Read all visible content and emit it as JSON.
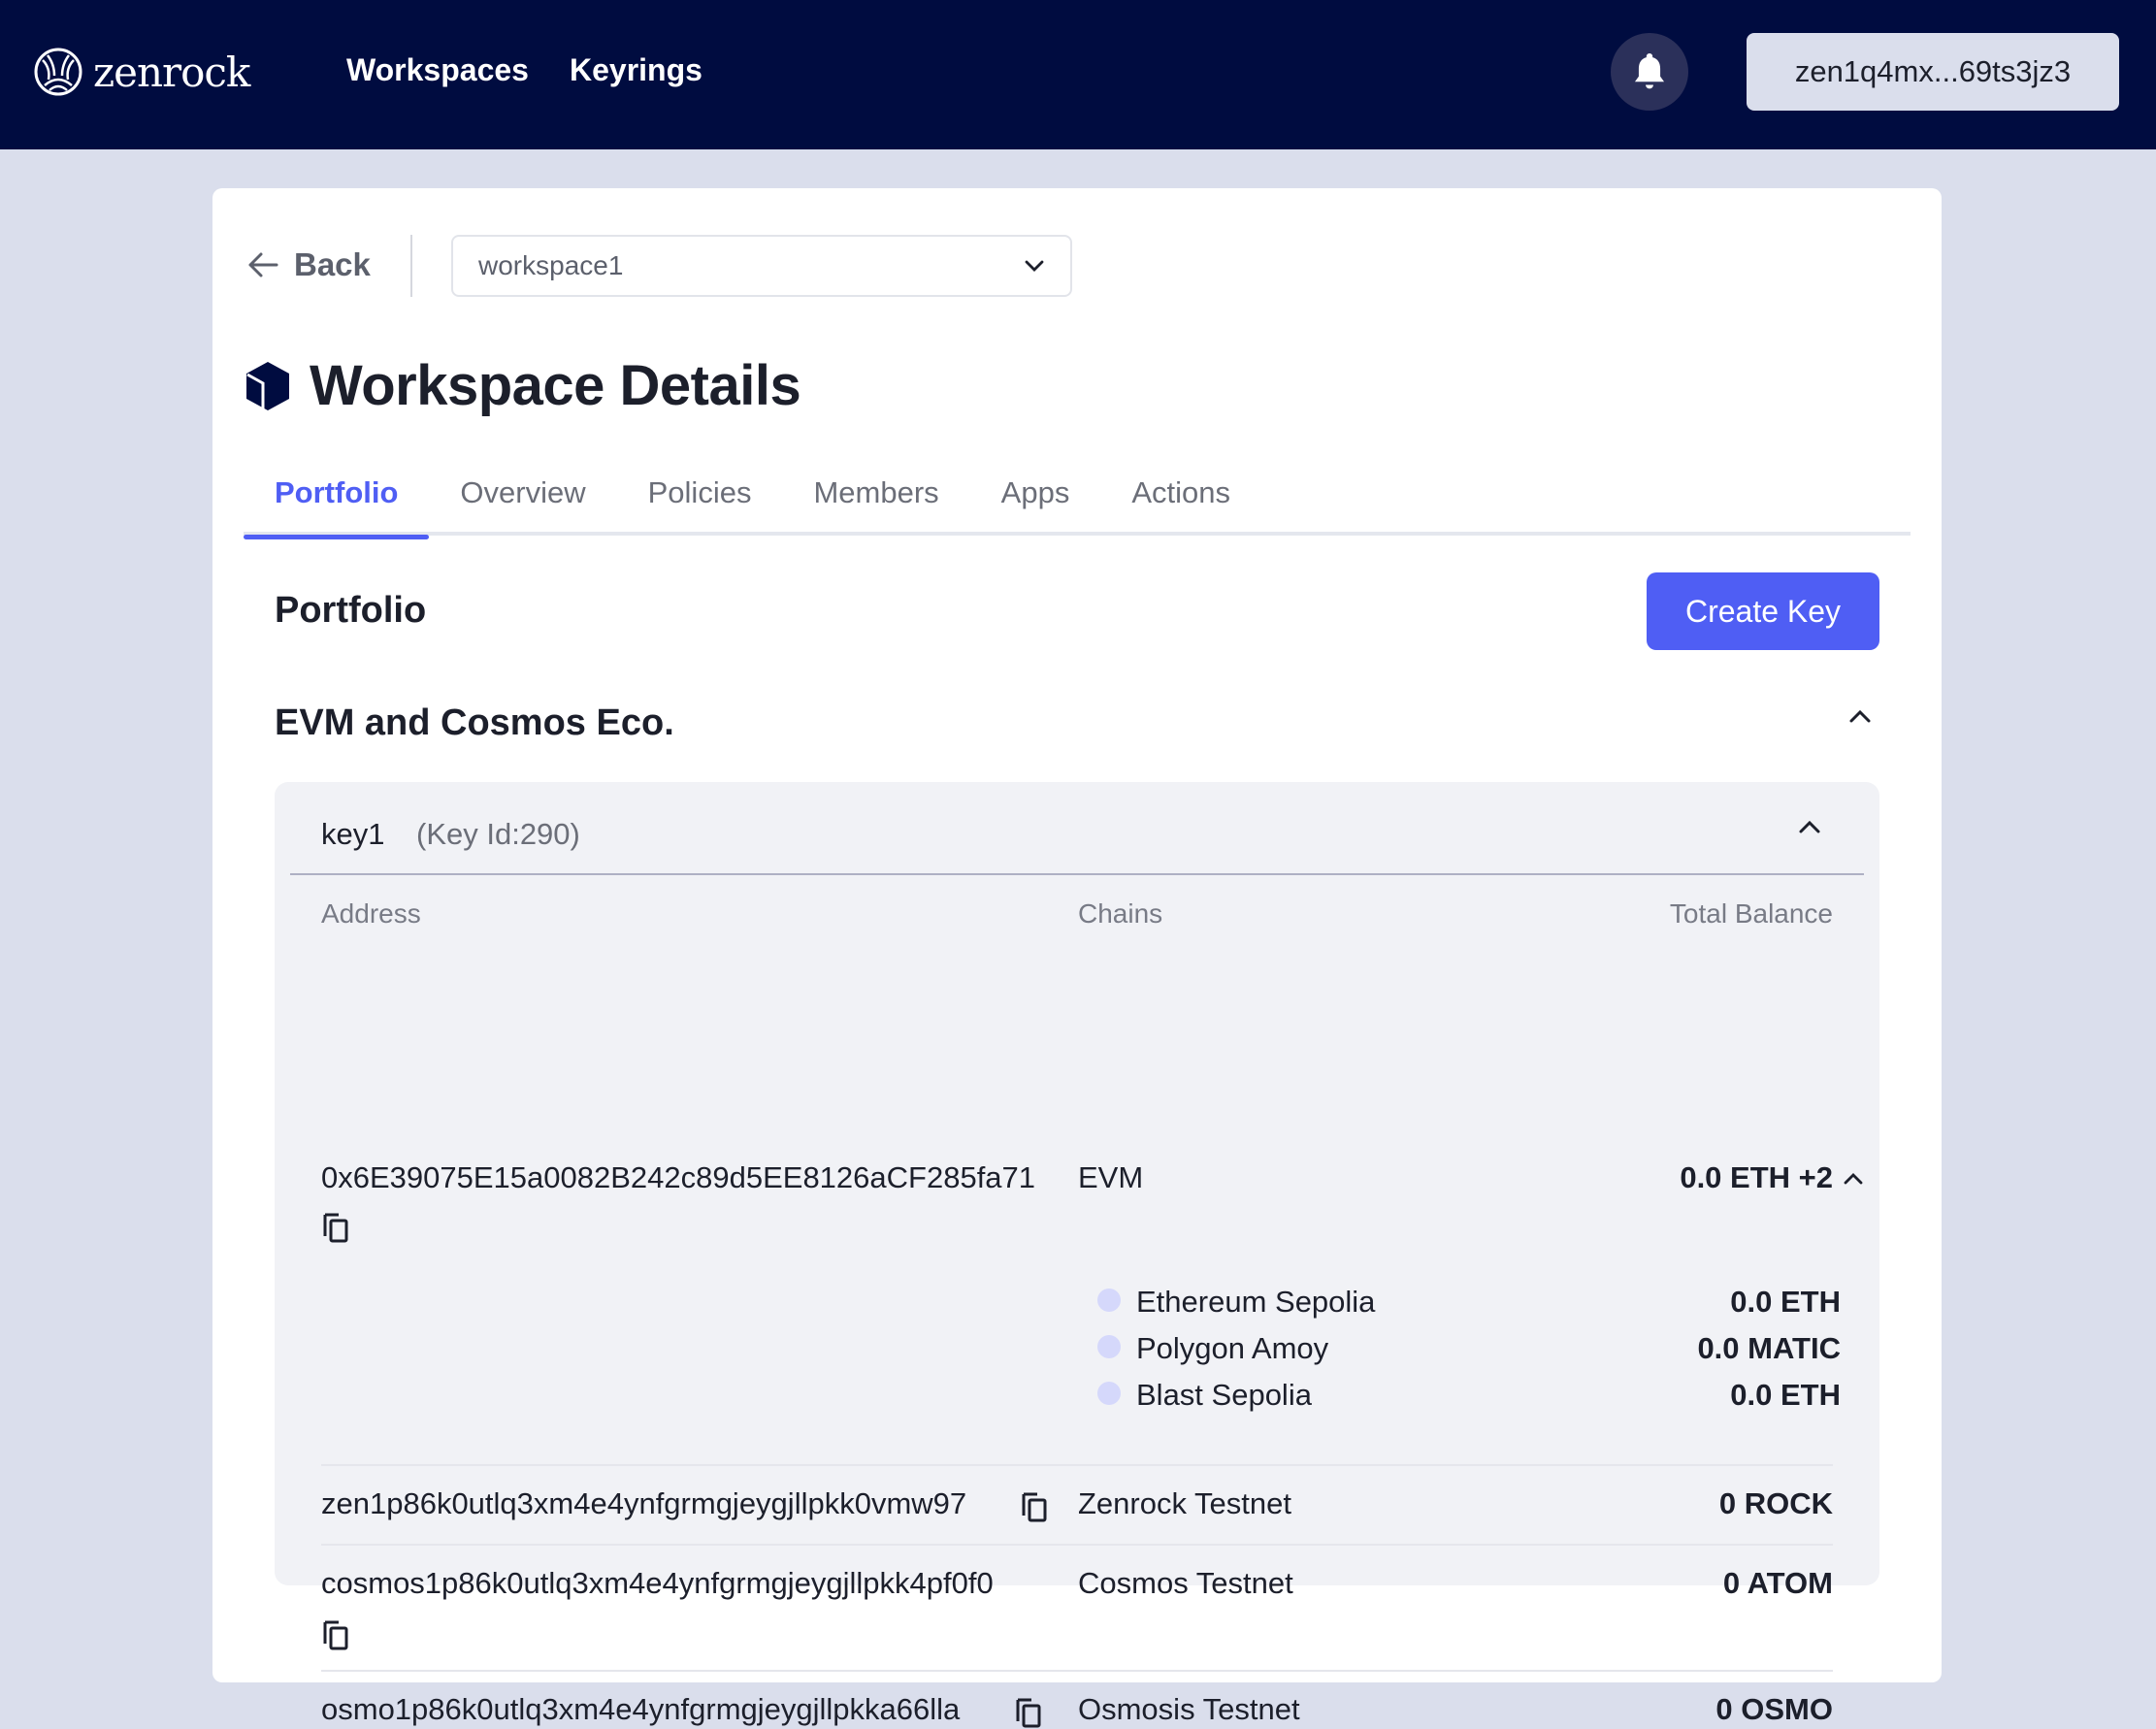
{
  "header": {
    "logo_text": "zenrock",
    "nav": [
      {
        "label": "Workspaces"
      },
      {
        "label": "Keyrings"
      }
    ],
    "wallet_address": "zen1q4mx...69ts3jz3"
  },
  "page": {
    "back_label": "Back",
    "workspace_select": {
      "value": "workspace1"
    },
    "title": "Workspace Details",
    "tabs": [
      {
        "label": "Portfolio",
        "active": true
      },
      {
        "label": "Overview",
        "active": false
      },
      {
        "label": "Policies",
        "active": false
      },
      {
        "label": "Members",
        "active": false
      },
      {
        "label": "Apps",
        "active": false
      },
      {
        "label": "Actions",
        "active": false
      }
    ],
    "section_title": "Portfolio",
    "create_key_label": "Create Key",
    "group_title": "EVM and Cosmos Eco."
  },
  "key": {
    "name": "key1",
    "id_label": "(Key Id:290)",
    "columns": {
      "address": "Address",
      "chains": "Chains",
      "balance": "Total Balance"
    },
    "rows": [
      {
        "address": "0x6E39075E15a0082B242c89d5EE8126aCF285fa71",
        "chain": "EVM",
        "balance": "0.0 ETH +2",
        "sub_chains": [
          {
            "name": "Ethereum Sepolia",
            "balance": "0.0 ETH"
          },
          {
            "name": "Polygon Amoy",
            "balance": "0.0 MATIC"
          },
          {
            "name": "Blast Sepolia",
            "balance": "0.0 ETH"
          }
        ]
      },
      {
        "address": "zen1p86k0utlq3xm4e4ynfgrmgjeygjllpkk0vmw97",
        "chain": "Zenrock Testnet",
        "balance": "0 ROCK"
      },
      {
        "address": "cosmos1p86k0utlq3xm4e4ynfgrmgjeygjllpkk4pf0f0",
        "chain": "Cosmos Testnet",
        "balance": "0 ATOM"
      },
      {
        "address": "osmo1p86k0utlq3xm4e4ynfgrmgjeygjllpkka66lla",
        "chain": "Osmosis Testnet",
        "balance": "0 OSMO"
      }
    ]
  },
  "colors": {
    "nav_bg": "#000c40",
    "accent": "#4f5ef4",
    "page_bg": "#dadeec",
    "panel_bg": "#f1f2f6"
  }
}
